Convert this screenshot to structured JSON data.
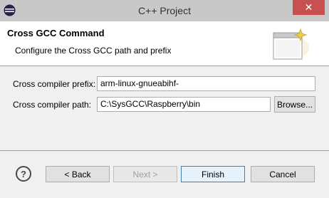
{
  "window": {
    "title": "C++ Project",
    "close_glyph": "✕"
  },
  "header": {
    "title": "Cross GCC Command",
    "description": "Configure the Cross GCC path and prefix"
  },
  "form": {
    "prefix_label": "Cross compiler prefix:",
    "prefix_value": "arm-linux-gnueabihf-",
    "path_label": "Cross compiler path:",
    "path_value": "C:\\SysGCC\\Raspberry\\bin",
    "browse_label": "Browse..."
  },
  "footer": {
    "help_glyph": "?",
    "back_label": "< Back",
    "next_label": "Next >",
    "finish_label": "Finish",
    "cancel_label": "Cancel"
  }
}
